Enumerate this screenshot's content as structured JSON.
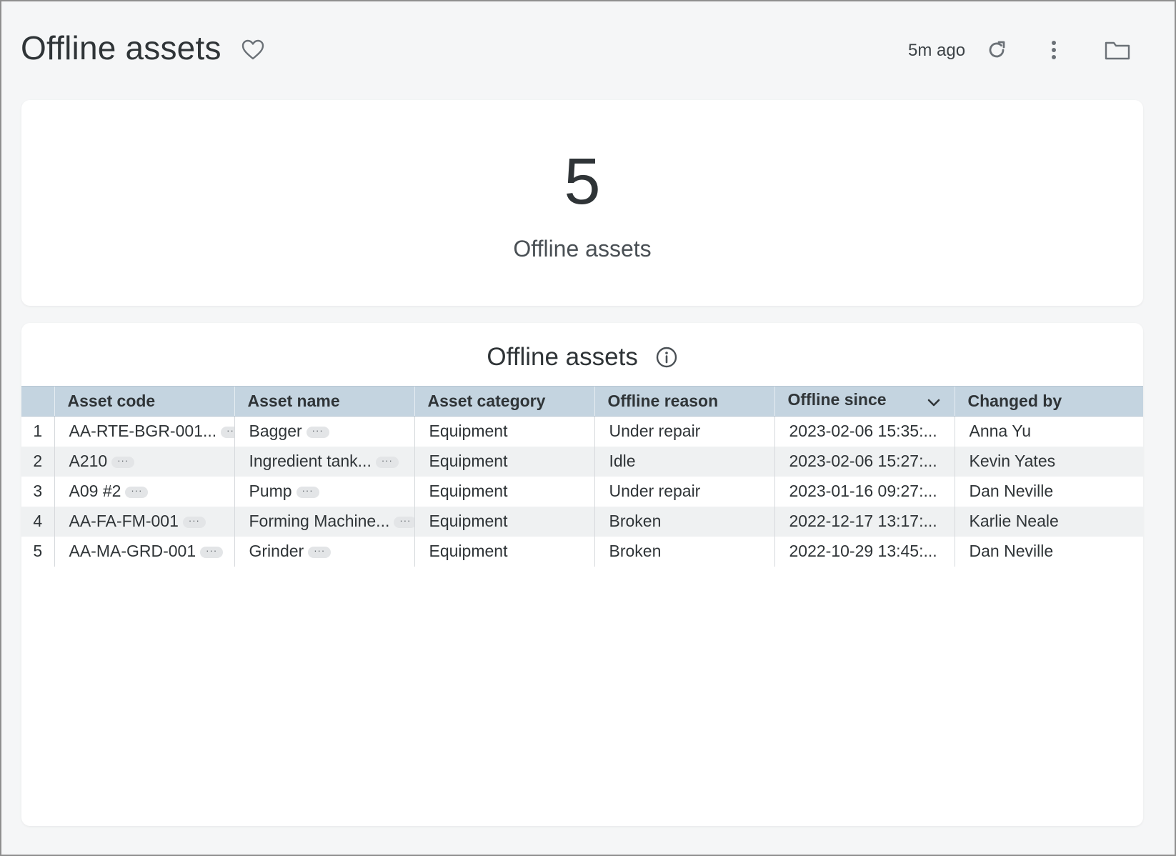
{
  "header": {
    "title": "Offline assets",
    "last_updated": "5m ago",
    "icons": {
      "favorite": "heart-outline-icon",
      "refresh": "refresh-icon",
      "more": "kebab-menu-icon",
      "folder": "folder-icon"
    }
  },
  "kpi": {
    "value": "5",
    "label": "Offline assets"
  },
  "table": {
    "title": "Offline assets",
    "info_icon": "info-icon",
    "columns": [
      {
        "label": "Asset code"
      },
      {
        "label": "Asset name"
      },
      {
        "label": "Asset category"
      },
      {
        "label": "Offline reason"
      },
      {
        "label": "Offline since",
        "sorted": "descending"
      },
      {
        "label": "Changed by"
      }
    ],
    "more_indicator": "···",
    "rows": [
      {
        "index": "1",
        "asset_code": "AA-RTE-BGR-001...",
        "asset_name": "Bagger",
        "asset_category": "Equipment",
        "offline_reason": "Under repair",
        "offline_since": "2023-02-06 15:35:...",
        "changed_by": "Anna Yu"
      },
      {
        "index": "2",
        "asset_code": "A210",
        "asset_name": "Ingredient tank...",
        "asset_category": "Equipment",
        "offline_reason": "Idle",
        "offline_since": "2023-02-06 15:27:...",
        "changed_by": "Kevin Yates"
      },
      {
        "index": "3",
        "asset_code": "A09 #2",
        "asset_name": "Pump",
        "asset_category": "Equipment",
        "offline_reason": "Under repair",
        "offline_since": "2023-01-16 09:27:...",
        "changed_by": "Dan Neville"
      },
      {
        "index": "4",
        "asset_code": "AA-FA-FM-001",
        "asset_name": "Forming Machine...",
        "asset_category": "Equipment",
        "offline_reason": "Broken",
        "offline_since": "2022-12-17 13:17:...",
        "changed_by": "Karlie Neale"
      },
      {
        "index": "5",
        "asset_code": "AA-MA-GRD-001",
        "asset_name": "Grinder",
        "asset_category": "Equipment",
        "offline_reason": "Broken",
        "offline_since": "2022-10-29 13:45:...",
        "changed_by": "Dan Neville"
      }
    ]
  },
  "colors": {
    "page_background": "#f5f6f7",
    "header_row": "#c4d4e0",
    "alt_row": "#eff1f2",
    "text": "#2f3437"
  }
}
